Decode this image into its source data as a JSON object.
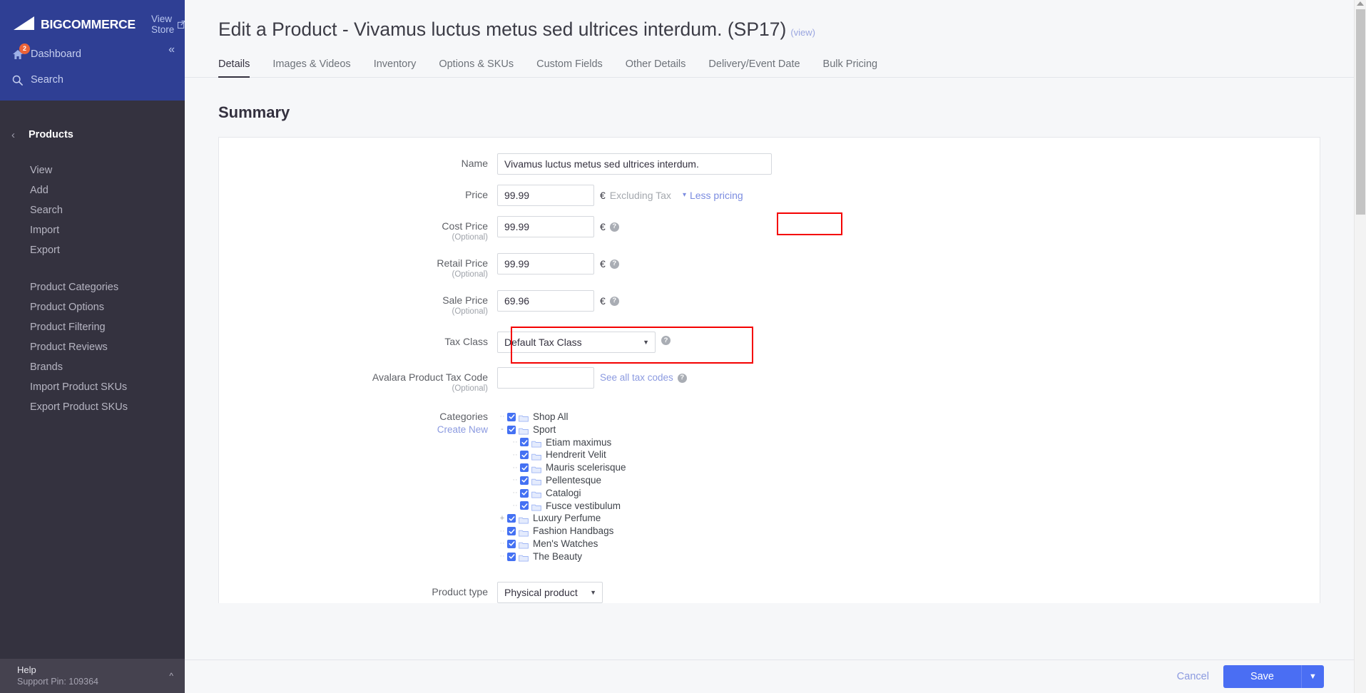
{
  "sidebar": {
    "brand": "BIGCOMMERCE",
    "view_store": "View Store",
    "dashboard": "Dashboard",
    "dashboard_badge": "2",
    "search": "Search",
    "section_title": "Products",
    "links_primary": [
      "View",
      "Add",
      "Search",
      "Import",
      "Export"
    ],
    "links_secondary": [
      "Product Categories",
      "Product Options",
      "Product Filtering",
      "Product Reviews",
      "Brands",
      "Import Product SKUs",
      "Export Product SKUs"
    ],
    "help_title": "Help",
    "help_subtitle": "Support Pin: 109364"
  },
  "header": {
    "title": "Edit a Product - Vivamus luctus metus sed ultrices interdum. (SP17)",
    "view_link": "(view)"
  },
  "tabs": [
    {
      "label": "Details",
      "active": true
    },
    {
      "label": "Images & Videos",
      "active": false
    },
    {
      "label": "Inventory",
      "active": false
    },
    {
      "label": "Options & SKUs",
      "active": false
    },
    {
      "label": "Custom Fields",
      "active": false
    },
    {
      "label": "Other Details",
      "active": false
    },
    {
      "label": "Delivery/Event Date",
      "active": false
    },
    {
      "label": "Bulk Pricing",
      "active": false
    }
  ],
  "form": {
    "section_title": "Summary",
    "optional_text": "(Optional)",
    "currency_symbol": "€",
    "name": {
      "label": "Name",
      "value": "Vivamus luctus metus sed ultrices interdum."
    },
    "price": {
      "label": "Price",
      "value": "99.99",
      "tax_note": "Excluding Tax",
      "less_pricing": "Less pricing"
    },
    "cost_price": {
      "label": "Cost Price",
      "value": "99.99"
    },
    "retail_price": {
      "label": "Retail Price",
      "value": "99.99"
    },
    "sale_price": {
      "label": "Sale Price",
      "value": "69.96"
    },
    "tax_class": {
      "label": "Tax Class",
      "value": "Default Tax Class"
    },
    "avalara": {
      "label": "Avalara Product Tax Code",
      "value": "",
      "see_all": "See all tax codes"
    },
    "categories": {
      "label": "Categories",
      "create_new": "Create New",
      "tree": [
        {
          "label": "Shop All",
          "depth": 0,
          "checked": true,
          "expander": ""
        },
        {
          "label": "Sport",
          "depth": 0,
          "checked": true,
          "expander": "-"
        },
        {
          "label": "Etiam maximus",
          "depth": 1,
          "checked": true,
          "expander": ""
        },
        {
          "label": "Hendrerit Velit",
          "depth": 1,
          "checked": true,
          "expander": ""
        },
        {
          "label": "Mauris scelerisque",
          "depth": 1,
          "checked": true,
          "expander": ""
        },
        {
          "label": "Pellentesque",
          "depth": 1,
          "checked": true,
          "expander": ""
        },
        {
          "label": "Catalogi",
          "depth": 1,
          "checked": true,
          "expander": ""
        },
        {
          "label": "Fusce vestibulum",
          "depth": 1,
          "checked": true,
          "expander": ""
        },
        {
          "label": "Luxury Perfume",
          "depth": 0,
          "checked": true,
          "expander": "+"
        },
        {
          "label": "Fashion Handbags",
          "depth": 0,
          "checked": true,
          "expander": ""
        },
        {
          "label": "Men's Watches",
          "depth": 0,
          "checked": true,
          "expander": ""
        },
        {
          "label": "The Beauty",
          "depth": 0,
          "checked": true,
          "expander": ""
        }
      ]
    },
    "product_type": {
      "label": "Product type",
      "value": "Physical product"
    }
  },
  "footer": {
    "cancel": "Cancel",
    "save": "Save"
  },
  "colors": {
    "sidebar_top": "#2f3f94",
    "sidebar_body": "#34323f",
    "accent_blue": "#4a6ef3",
    "link_blue": "#8b9ae0",
    "badge_orange": "#ec6338",
    "annotation_red": "#f40000",
    "checkbox_blue": "#4471f3"
  }
}
